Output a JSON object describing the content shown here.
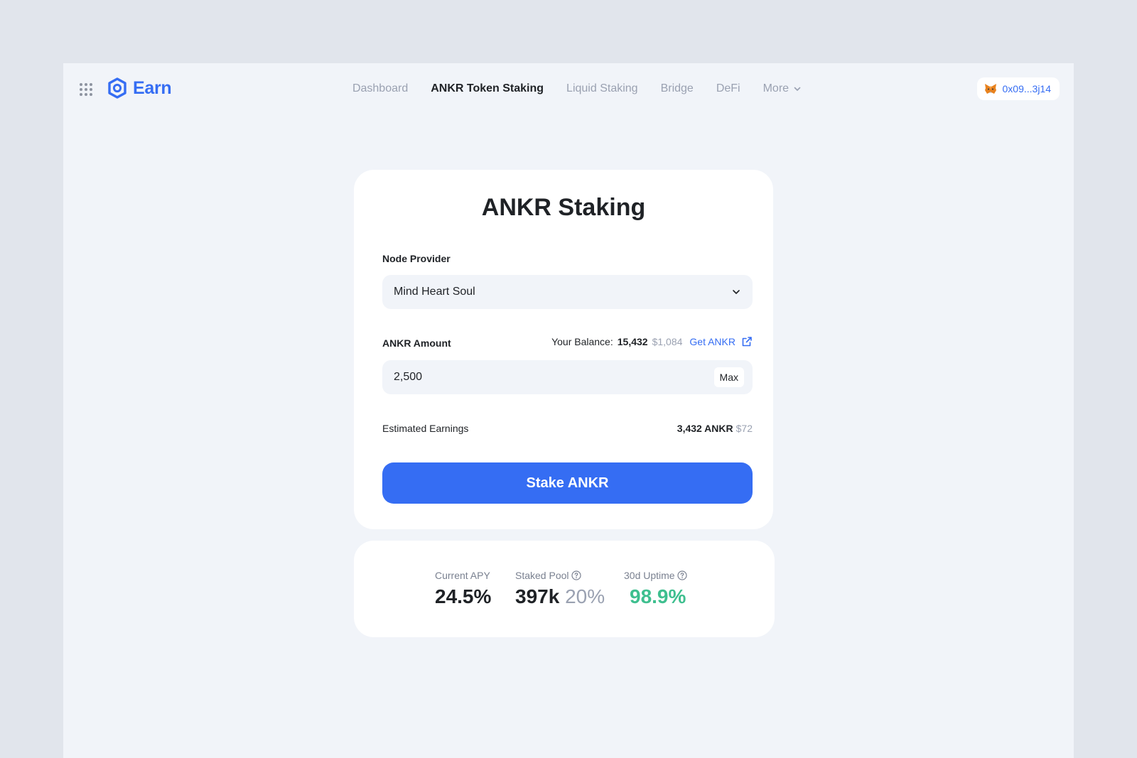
{
  "header": {
    "logo_text": "Earn",
    "nav": [
      {
        "label": "Dashboard",
        "active": false
      },
      {
        "label": "ANKR Token Staking",
        "active": true
      },
      {
        "label": "Liquid Staking",
        "active": false
      },
      {
        "label": "Bridge",
        "active": false
      },
      {
        "label": "DeFi",
        "active": false
      },
      {
        "label": "More",
        "active": false
      }
    ],
    "wallet_address": "0x09...3j14",
    "icons": {
      "apps": "grid-icon",
      "logo": "ankr-logo-icon",
      "wallet": "metamask-fox-icon",
      "more": "chevron-down-icon"
    }
  },
  "staking": {
    "title": "ANKR Staking",
    "node_provider_label": "Node Provider",
    "node_provider_value": "Mind Heart Soul",
    "amount_label": "ANKR Amount",
    "balance_label": "Your Balance:",
    "balance_value": "15,432",
    "balance_usd": "$1,084",
    "get_link": "Get ANKR",
    "amount_value": "2,500",
    "max_label": "Max",
    "estimated_label": "Estimated Earnings",
    "estimated_value": "3,432 ANKR",
    "estimated_usd": "$72",
    "stake_button": "Stake ANKR"
  },
  "stats": {
    "apy_label": "Current APY",
    "apy_value": "24.5%",
    "pool_label": "Staked Pool",
    "pool_value": "397k",
    "pool_percent": "20%",
    "uptime_label": "30d Uptime",
    "uptime_value": "98.9%"
  },
  "colors": {
    "accent": "#356df3",
    "success": "#3ebf8f",
    "background": "#f1f4f9",
    "frame": "#e1e5ec"
  }
}
